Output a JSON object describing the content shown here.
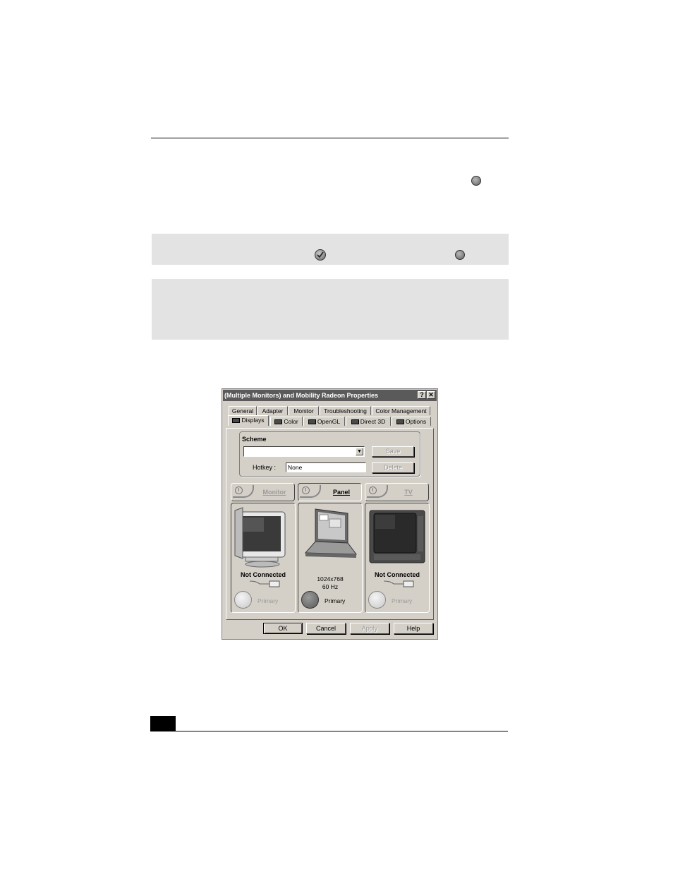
{
  "dialog": {
    "title": "(Multiple Monitors) and Mobility Radeon Properties",
    "help_btn": "?",
    "close_btn": "✕",
    "tabs_row1": [
      "General",
      "Adapter",
      "Monitor",
      "Troubleshooting",
      "Color Management"
    ],
    "tabs_row2": [
      "Displays",
      "Color",
      "OpenGL",
      "Direct 3D",
      "Options"
    ],
    "scheme": {
      "label": "Scheme",
      "value": "",
      "save": "Save",
      "delete": "Delete",
      "hotkey_label": "Hotkey :",
      "hotkey_value": "None"
    },
    "devices": [
      {
        "label": "Monitor",
        "status": "Not Connected",
        "primary": "Primary",
        "resolution": "",
        "refresh": ""
      },
      {
        "label": "Panel",
        "status": "",
        "primary": "Primary",
        "resolution": "1024x768",
        "refresh": "60 Hz"
      },
      {
        "label": "TV",
        "status": "Not Connected",
        "primary": "Primary",
        "resolution": "",
        "refresh": ""
      }
    ],
    "buttons": {
      "ok": "OK",
      "cancel": "Cancel",
      "apply": "Apply",
      "help": "Help"
    }
  }
}
